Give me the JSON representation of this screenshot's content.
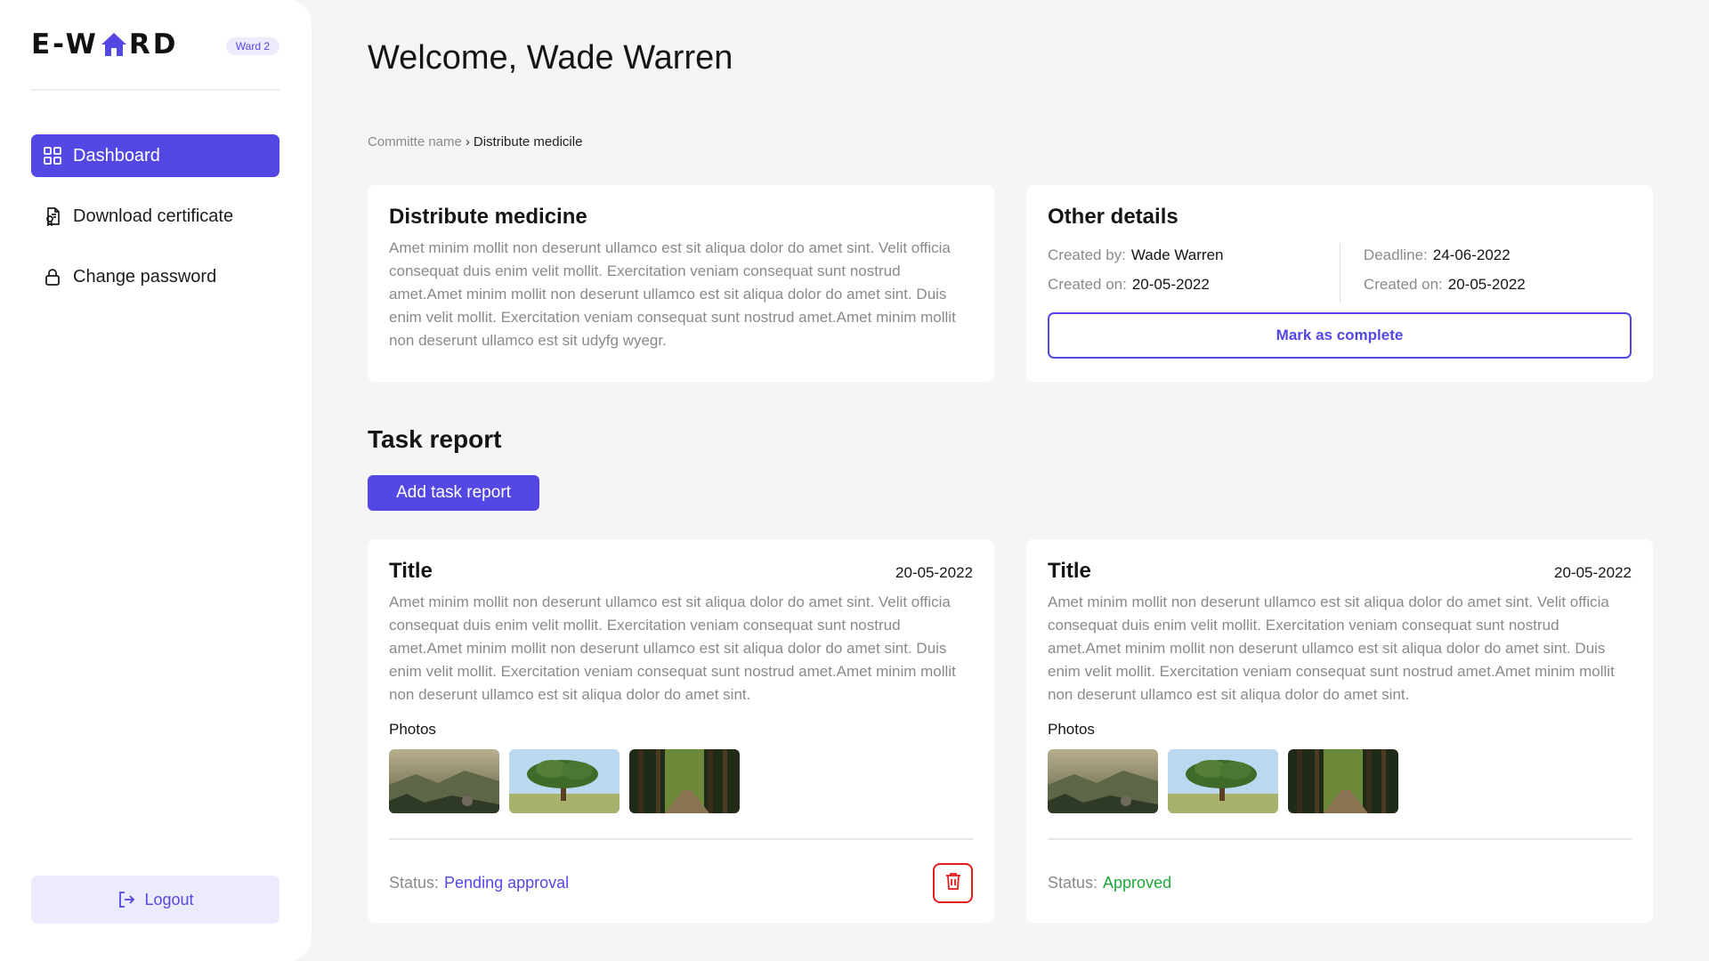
{
  "brand": {
    "logo_prefix": "E-W",
    "logo_suffix": "RD",
    "ward_badge": "Ward 2"
  },
  "sidebar": {
    "items": [
      {
        "label": "Dashboard",
        "icon": "grid-icon",
        "active": true
      },
      {
        "label": "Download certificate",
        "icon": "certificate-icon",
        "active": false
      },
      {
        "label": "Change password",
        "icon": "lock-icon",
        "active": false
      }
    ],
    "logout_label": "Logout"
  },
  "header": {
    "welcome": "Welcome, Wade Warren"
  },
  "breadcrumb": {
    "parent": "Committe name",
    "separator": "›",
    "current": "Distribute medicile"
  },
  "task": {
    "title": "Distribute medicine",
    "description": "Amet minim mollit non deserunt ullamco est sit aliqua dolor do amet sint. Velit officia consequat duis enim velit mollit. Exercitation veniam consequat sunt nostrud amet.Amet minim mollit non deserunt ullamco est sit aliqua dolor do amet sint. Duis enim velit mollit. Exercitation veniam consequat sunt nostrud amet.Amet minim mollit non deserunt ullamco est sit udyfg wyegr."
  },
  "details": {
    "title": "Other details",
    "created_by_label": "Created by:",
    "created_by": "Wade Warren",
    "created_on_label": "Created on:",
    "created_on": "20-05-2022",
    "deadline_label": "Deadline:",
    "deadline": "24-06-2022",
    "created_on_label_2": "Created on:",
    "created_on_2": "20-05-2022",
    "mark_complete": "Mark as complete"
  },
  "task_report": {
    "section_title": "Task report",
    "add_label": "Add task report",
    "reports": [
      {
        "title": "Title",
        "date": "20-05-2022",
        "description": "Amet minim mollit non deserunt ullamco est sit aliqua dolor do amet sint. Velit officia consequat duis enim velit mollit. Exercitation veniam consequat sunt nostrud amet.Amet minim mollit non deserunt ullamco est sit aliqua dolor do amet sint. Duis enim velit mollit. Exercitation veniam consequat sunt nostrud amet.Amet minim mollit non deserunt ullamco est sit aliqua dolor do amet sint.",
        "photos_label": "Photos",
        "status_label": "Status:",
        "status": "Pending approval",
        "status_color": "#5448e5",
        "deletable": true
      },
      {
        "title": "Title",
        "date": "20-05-2022",
        "description": "Amet minim mollit non deserunt ullamco est sit aliqua dolor do amet sint. Velit officia consequat duis enim velit mollit. Exercitation veniam consequat sunt nostrud amet.Amet minim mollit non deserunt ullamco est sit aliqua dolor do amet sint. Duis enim velit mollit. Exercitation veniam consequat sunt nostrud amet.Amet minim mollit non deserunt ullamco est sit aliqua dolor do amet sint.",
        "photos_label": "Photos",
        "status_label": "Status:",
        "status": "Approved",
        "status_color": "#1fa83a",
        "deletable": false
      }
    ]
  },
  "colors": {
    "accent": "#5448e5",
    "accent_soft": "#ecebfd",
    "danger": "#e21b1b",
    "success": "#1fa83a",
    "background": "#f5f5f5"
  }
}
